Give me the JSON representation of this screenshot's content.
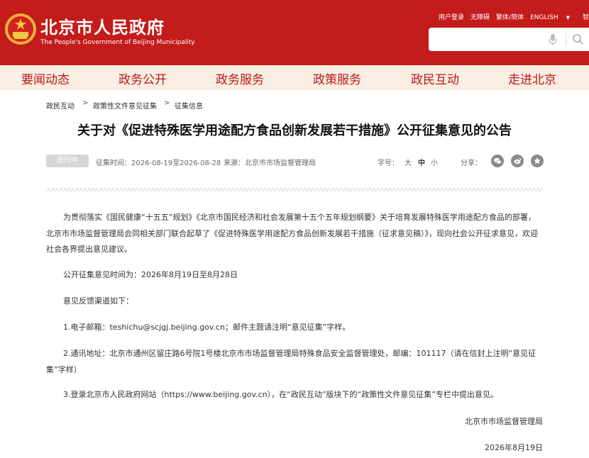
{
  "header": {
    "site_title": "北京市人民政府",
    "site_subtitle": "The People's Government of Beijing Municipality",
    "top_links": [
      "用户登录",
      "无障碍",
      "繁体/简体",
      "ENGLISH",
      "智能问答"
    ],
    "search": {
      "placeholder": ""
    }
  },
  "nav": {
    "items": [
      "要闻动态",
      "政务公开",
      "政务服务",
      "政策服务",
      "政民互动",
      "走进北京"
    ]
  },
  "breadcrumb": {
    "items": [
      "政民互动",
      "政策性文件意见征集",
      "征集信息"
    ],
    "separator": ">"
  },
  "article": {
    "title": "关于对《促进特殊医学用途配方食品创新发展若干措施》公开征集意见的公告",
    "status": "进行中",
    "period": "征集时间：2026-08-19至2026-08-28",
    "source": "来源：北京市市场监督管理局",
    "font_size_label": "字号：",
    "font_sizes": [
      "大",
      "中",
      "小"
    ],
    "share_label": "分享：",
    "paragraphs": [
      "为贯彻落实《国民健康“十五五”规划》《北京市国民经济和社会发展第十五个五年规划纲要》关于培育发展特殊医学用途配方食品的部署，北京市市场监督管理局会同相关部门联合起草了《促进特殊医学用途配方食品创新发展若干措施（征求意见稿）》，现向社会公开征求意见，欢迎社会各界提出意见建议。",
      "公开征集意见时间为：2026年8月19日至8月28日",
      "意见反馈渠道如下：",
      "1.电子邮箱：teshichu@scjgj.beijing.gov.cn；邮件主题请注明“意见征集”字样。",
      "2.通讯地址：北京市通州区留庄路6号院1号楼北京市市场监督管理局特殊食品安全监督管理处，邮编：101117（请在信封上注明“意见征集”字样）",
      "3.登录北京市人民政府网站（https://www.beijing.gov.cn），在“政民互动”版块下的“政策性文件意见征集”专栏中提出意见。"
    ],
    "signature": "北京市市场监督管理局",
    "date": "2026年8月19日"
  },
  "colors": {
    "header_red": "#c41b1b",
    "nav_bg": "#fbeee3",
    "nav_text": "#b7191b"
  },
  "icons": [
    "national-emblem-icon",
    "microphone-icon",
    "search-icon",
    "wechat-icon",
    "weibo-icon",
    "favorite-star-icon"
  ]
}
